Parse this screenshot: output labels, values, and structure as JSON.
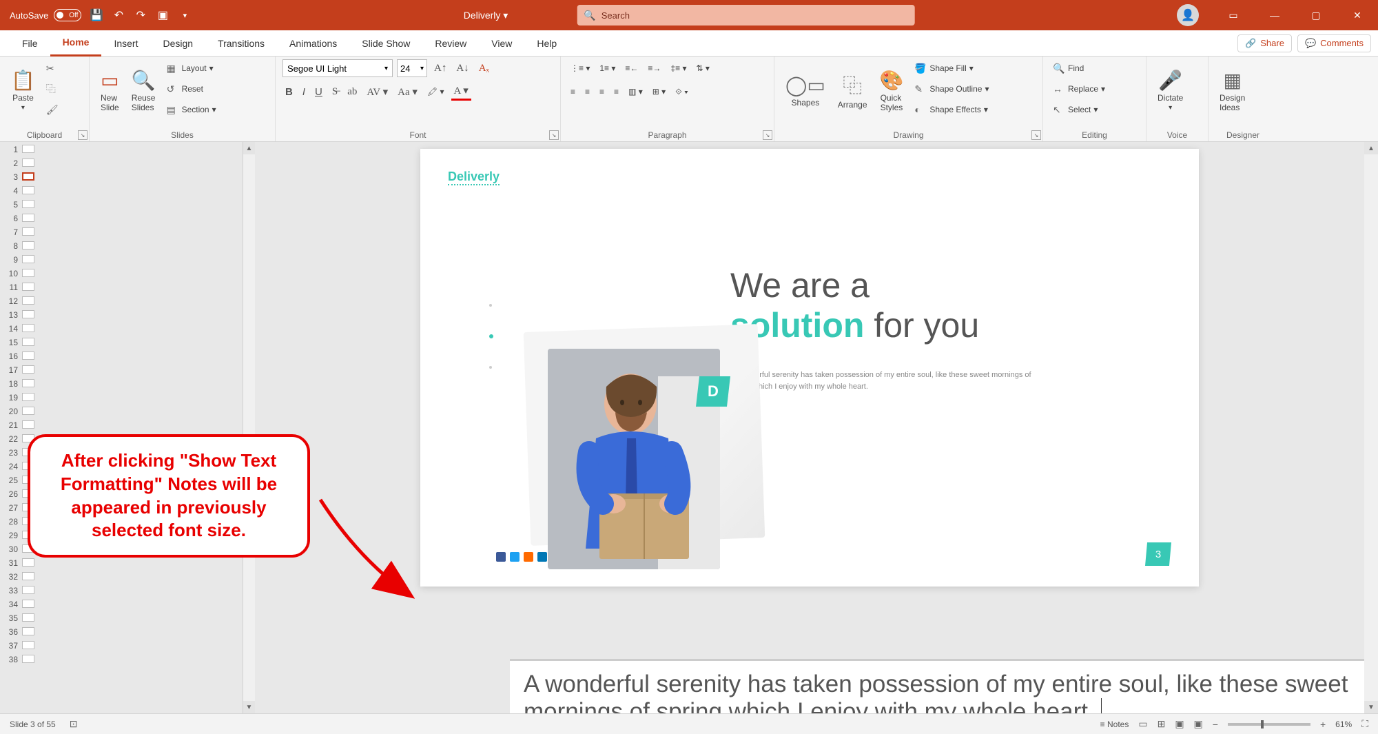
{
  "title_bar": {
    "autosave_label": "AutoSave",
    "autosave_state": "Off",
    "doc_name": "Deliverly",
    "search_placeholder": "Search"
  },
  "window_controls": {
    "minimize": "—",
    "maximize": "▢",
    "close": "✕",
    "ribbon_display": "▭"
  },
  "tabs": {
    "file": "File",
    "home": "Home",
    "insert": "Insert",
    "design": "Design",
    "transitions": "Transitions",
    "animations": "Animations",
    "slide_show": "Slide Show",
    "review": "Review",
    "view": "View",
    "help": "Help",
    "share": "Share",
    "comments": "Comments"
  },
  "ribbon": {
    "clipboard": {
      "label": "Clipboard",
      "paste": "Paste"
    },
    "slides": {
      "label": "Slides",
      "new_slide": "New\nSlide",
      "reuse": "Reuse\nSlides",
      "layout": "Layout",
      "reset": "Reset",
      "section": "Section"
    },
    "font_group": {
      "label": "Font",
      "font_name": "Segoe UI Light",
      "font_size": "24"
    },
    "paragraph": {
      "label": "Paragraph"
    },
    "drawing": {
      "label": "Drawing",
      "shapes": "Shapes",
      "arrange": "Arrange",
      "quick": "Quick\nStyles",
      "fill": "Shape Fill",
      "outline": "Shape Outline",
      "effects": "Shape Effects"
    },
    "editing": {
      "label": "Editing",
      "find": "Find",
      "replace": "Replace",
      "select": "Select"
    },
    "voice": {
      "label": "Voice",
      "dictate": "Dictate"
    },
    "designer": {
      "label": "Designer",
      "ideas": "Design\nIdeas"
    }
  },
  "slide": {
    "logo_a": "Deliver",
    "logo_b": "ly",
    "heading_1": "We are a",
    "heading_accent": "solution",
    "heading_2": " for you",
    "body": "A wonderful serenity has taken possession of my entire soul, like these sweet mornings of spring which I enjoy with my whole heart.",
    "d_badge": "D",
    "page_num": "3"
  },
  "thumbnails": {
    "count": 38,
    "selected": 3
  },
  "notes": {
    "text": "A wonderful serenity has taken possession of my entire soul, like these sweet mornings of spring which I enjoy with my whole heart."
  },
  "status": {
    "slide_info": "Slide 3 of 55",
    "notes": "Notes",
    "zoom": "61%"
  },
  "callout": {
    "text": "After clicking \"Show Text Formatting\" Notes will be appeared in previously selected font size."
  },
  "social_colors": [
    "#3b5998",
    "#1da1f2",
    "#ff6a00",
    "#0077b5"
  ]
}
